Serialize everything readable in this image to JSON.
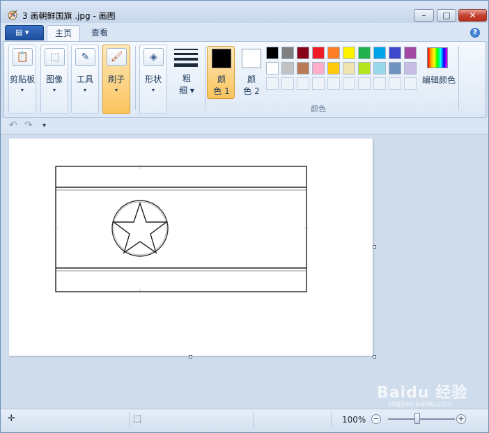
{
  "window": {
    "title": "3 画朝鲜国旗 .jpg - 画图",
    "minimize_glyph": "–",
    "maximize_glyph": "□",
    "close_glyph": "✕"
  },
  "tabs": [
    {
      "label": "主页"
    },
    {
      "label": "查看"
    }
  ],
  "help_glyph": "?",
  "ribbon": {
    "clipboard": {
      "label": "剪贴板",
      "icon": "clipboard-icon"
    },
    "image": {
      "label": "图像",
      "icon": "select-icon"
    },
    "tools": {
      "label": "工具",
      "icon": "tools-icon"
    },
    "brushes": {
      "label": "刷子",
      "icon": "brush-icon"
    },
    "shapes": {
      "label": "形状",
      "icon": "shapes-icon"
    },
    "size": {
      "label_top": "粗",
      "label_bottom": "细"
    },
    "color1": {
      "label_top": "颜",
      "label_bottom": "色 1",
      "color": "#000000"
    },
    "color2": {
      "label_top": "颜",
      "label_bottom": "色 2",
      "color": "#ffffff"
    },
    "edit_colors": {
      "label": "编辑颜色"
    },
    "colors_group_label": "颜色",
    "palette_row1": [
      "#000000",
      "#7f7f7f",
      "#880015",
      "#ed1c24",
      "#ff7f27",
      "#fff200",
      "#22b14c",
      "#00a2e8",
      "#3f48cc",
      "#a349a4"
    ],
    "palette_row2": [
      "#ffffff",
      "#c3c3c3",
      "#b97a57",
      "#ffaec9",
      "#ffc90e",
      "#efe4b0",
      "#b5e61d",
      "#99d9ea",
      "#7092be",
      "#c8bfe7"
    ]
  },
  "status": {
    "zoom": "100%",
    "zoom_out": "−",
    "zoom_in": "+"
  },
  "watermark": {
    "text": "Baidu 经验",
    "sub": "jingyan.baidu.com"
  }
}
